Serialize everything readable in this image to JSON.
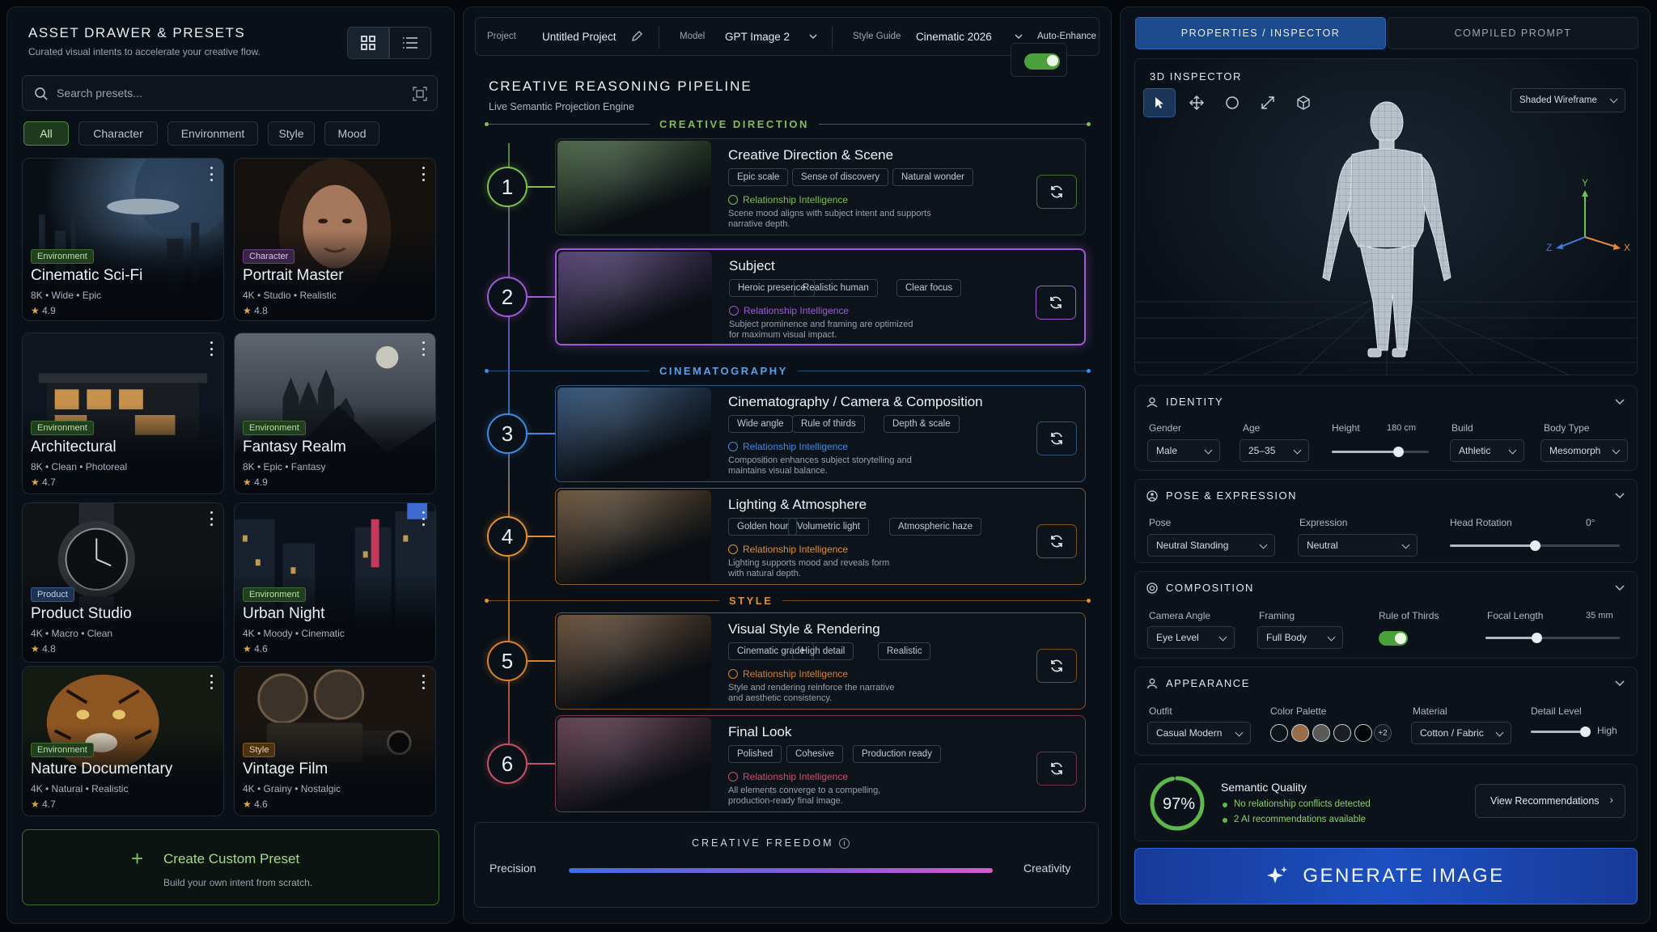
{
  "drawer": {
    "title": "ASSET DRAWER & PRESETS",
    "subtitle": "Curated visual intents to accelerate your creative flow.",
    "search_placeholder": "Search presets...",
    "filters": [
      "All",
      "Character",
      "Environment",
      "Style",
      "Mood"
    ],
    "cards": [
      {
        "badge": "Environment",
        "title": "Cinematic Sci-Fi",
        "meta": "8K  •  Wide  •  Epic",
        "rating": "4.9"
      },
      {
        "badge": "Character",
        "title": "Portrait Master",
        "meta": "4K  •  Studio  •  Realistic",
        "rating": "4.8"
      },
      {
        "badge": "Environment",
        "title": "Architectural",
        "meta": "8K  •  Clean  •  Photoreal",
        "rating": "4.7"
      },
      {
        "badge": "Environment",
        "title": "Fantasy Realm",
        "meta": "8K  •  Epic  •  Fantasy",
        "rating": "4.9"
      },
      {
        "badge": "Product",
        "title": "Product Studio",
        "meta": "4K  •  Macro  •  Clean",
        "rating": "4.8"
      },
      {
        "badge": "Environment",
        "title": "Urban Night",
        "meta": "4K  •  Moody  •  Cinematic",
        "rating": "4.6"
      },
      {
        "badge": "Environment",
        "title": "Nature Documentary",
        "meta": "4K  •  Natural  •  Realistic",
        "rating": "4.7"
      },
      {
        "badge": "Style",
        "title": "Vintage Film",
        "meta": "4K  •  Grainy  •  Nostalgic",
        "rating": "4.6"
      }
    ],
    "create_title": "Create Custom Preset",
    "create_sub": "Build your own intent from scratch."
  },
  "topbar": {
    "project_label": "Project",
    "project_value": "Untitled Project",
    "model_label": "Model",
    "model_value": "GPT Image 2",
    "style_label": "Style Guide",
    "style_value": "Cinematic 2026",
    "auto_label": "Auto-Enhance",
    "auto_on": true
  },
  "pipeline": {
    "title": "CREATIVE REASONING PIPELINE",
    "subtitle": "Live Semantic Projection Engine",
    "sections": {
      "direction": "CREATIVE DIRECTION",
      "cinematography": "CINEMATOGRAPHY",
      "style": "STYLE"
    },
    "stages": [
      {
        "num": "1",
        "title": "Creative Direction & Scene",
        "chips": [
          "Epic scale",
          "Sense of discovery",
          "Natural wonder"
        ],
        "ri": "Relationship Intelligence",
        "desc1": "Scene mood aligns with subject intent and supports",
        "desc2": "narrative depth.",
        "color": "#7fbf4f"
      },
      {
        "num": "2",
        "title": "Subject",
        "chips": [
          "Heroic presence",
          "Realistic human",
          "Clear focus"
        ],
        "ri": "Relationship Intelligence",
        "desc1": "Subject prominence and framing are optimized",
        "desc2": "for maximum visual impact.",
        "color": "#a05ad6"
      },
      {
        "num": "3",
        "title": "Cinematography / Camera & Composition",
        "chips": [
          "Wide angle",
          "Rule of thirds",
          "Depth & scale"
        ],
        "ri": "Relationship Intelligence",
        "desc1": "Composition enhances subject storytelling and",
        "desc2": "maintains visual balance.",
        "color": "#3f8be0"
      },
      {
        "num": "4",
        "title": "Lighting & Atmosphere",
        "chips": [
          "Golden hour",
          "Volumetric light",
          "Atmospheric haze"
        ],
        "ri": "Relationship Intelligence",
        "desc1": "Lighting supports mood and reveals form",
        "desc2": "with natural depth.",
        "color": "#e0902f"
      },
      {
        "num": "5",
        "title": "Visual Style & Rendering",
        "chips": [
          "Cinematic grade",
          "High detail",
          "Realistic"
        ],
        "ri": "Relationship Intelligence",
        "desc1": "Style and rendering reinforce the narrative",
        "desc2": "and aesthetic consistency.",
        "color": "#d9802a"
      },
      {
        "num": "6",
        "title": "Final Look",
        "chips": [
          "Polished",
          "Cohesive",
          "Production ready"
        ],
        "ri": "Relationship Intelligence",
        "desc1": "All elements converge to a compelling,",
        "desc2": "production-ready final image.",
        "color": "#c9506a"
      }
    ],
    "freedom_title": "CREATIVE FREEDOM",
    "freedom_left": "Precision",
    "freedom_right": "Creativity",
    "freedom_value": 0.72
  },
  "inspector": {
    "tabs": [
      "PROPERTIES / INSPECTOR",
      "COMPILED PROMPT"
    ],
    "viewer_title": "3D INSPECTOR",
    "render_mode": "Shaded Wireframe",
    "axes": {
      "x": "X",
      "y": "Y",
      "z": "Z"
    },
    "identity": {
      "title": "IDENTITY",
      "gender_label": "Gender",
      "gender": "Male",
      "age_label": "Age",
      "age": "25–35",
      "height_label": "Height",
      "height": "180 cm",
      "height_level": 0.68,
      "build_label": "Build",
      "build": "Athletic",
      "body_label": "Body Type",
      "body": "Mesomorph"
    },
    "pose": {
      "title": "POSE & EXPRESSION",
      "pose_label": "Pose",
      "pose": "Neutral Standing",
      "expr_label": "Expression",
      "expr": "Neutral",
      "head_label": "Head Rotation",
      "head": "0°",
      "head_level": 0.5
    },
    "composition": {
      "title": "COMPOSITION",
      "angle_label": "Camera Angle",
      "angle": "Eye Level",
      "framing_label": "Framing",
      "framing": "Full Body",
      "thirds_label": "Rule of Thirds",
      "thirds_on": true,
      "focal_label": "Focal Length",
      "focal": "35 mm",
      "focal_level": 0.38
    },
    "appearance": {
      "title": "APPEARANCE",
      "outfit_label": "Outfit",
      "outfit": "Casual Modern",
      "palette_label": "Color Palette",
      "palette": [
        "#0f141a",
        "#9a6c48",
        "#5c5a57",
        "#1b1f24",
        "#050608"
      ],
      "palette_more": "+2",
      "material_label": "Material",
      "material": "Cotton / Fabric",
      "detail_label": "Detail Level",
      "detail": "High",
      "detail_level": 0.95
    },
    "quality": {
      "score": "97%",
      "score_value": 0.97,
      "title": "Semantic Quality",
      "line1": "No relationship conflicts detected",
      "line2": "2 AI recommendations available",
      "button": "View Recommendations"
    },
    "generate": "GENERATE IMAGE"
  },
  "colors": {
    "accent_green": "#4aa03a",
    "accent_blue": "#1d4fb8",
    "purple": "#a05ad6"
  }
}
